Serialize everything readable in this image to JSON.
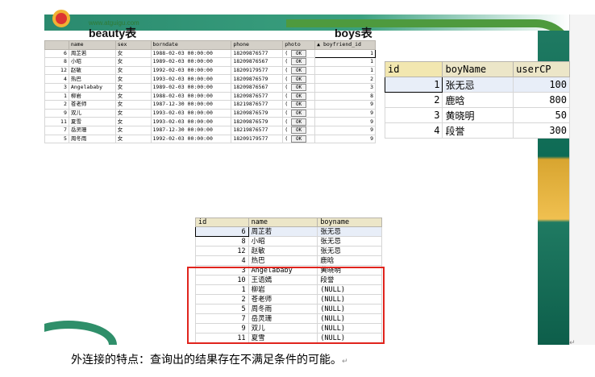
{
  "logo": {
    "url": "www.atguigu.com"
  },
  "captions": {
    "beauty": "beauty表",
    "boys": "boys表"
  },
  "beauty_table": {
    "columns": [
      "",
      "name",
      "sex",
      "borndate",
      "phone",
      "photo",
      "▲ boyfriend_id"
    ],
    "rows": [
      [
        "6",
        "周芷若",
        "女",
        "1988-02-03 00:00:00",
        "18209876577",
        "OK",
        "1"
      ],
      [
        "8",
        "小昭",
        "女",
        "1989-02-03 00:00:00",
        "18209876567",
        "OK",
        "1"
      ],
      [
        "12",
        "赵敏",
        "女",
        "1992-02-03 00:00:00",
        "18209179577",
        "OK",
        "1"
      ],
      [
        "4",
        "热巴",
        "女",
        "1993-02-03 00:00:00",
        "18209876579",
        "OK",
        "2"
      ],
      [
        "3",
        "Angelababy",
        "女",
        "1989-02-03 00:00:00",
        "18209876567",
        "OK",
        "3"
      ],
      [
        "1",
        "柳岩",
        "女",
        "1988-02-03 00:00:00",
        "18209876577",
        "OK",
        "8"
      ],
      [
        "2",
        "苍老师",
        "女",
        "1987-12-30 00:00:00",
        "18219876577",
        "OK",
        "9"
      ],
      [
        "9",
        "双儿",
        "女",
        "1993-02-03 00:00:00",
        "18209876579",
        "OK",
        "9"
      ],
      [
        "11",
        "夏雪",
        "女",
        "1993-02-03 00:00:00",
        "18209876579",
        "OK",
        "9"
      ],
      [
        "7",
        "岳灵珊",
        "女",
        "1987-12-30 00:00:00",
        "18219876577",
        "OK",
        "9"
      ],
      [
        "5",
        "周冬雨",
        "女",
        "1992-02-03 00:00:00",
        "18209179577",
        "OK",
        "9"
      ]
    ]
  },
  "boys_table": {
    "columns": [
      "id",
      "boyName",
      "userCP"
    ],
    "rows": [
      [
        "1",
        "张无忌",
        "100"
      ],
      [
        "2",
        "鹿晗",
        "800"
      ],
      [
        "3",
        "黄晓明",
        "50"
      ],
      [
        "4",
        "段誉",
        "300"
      ]
    ]
  },
  "result_table": {
    "columns": [
      "id",
      "name",
      "boyname"
    ],
    "rows": [
      [
        "6",
        "周芷若",
        "张无忌"
      ],
      [
        "8",
        "小昭",
        "张无忌"
      ],
      [
        "12",
        "赵敏",
        "张无忌"
      ],
      [
        "4",
        "热巴",
        "鹿晗"
      ],
      [
        "3",
        "Angelababy",
        "黄晓明"
      ],
      [
        "10",
        "王语嫣",
        "段誉"
      ],
      [
        "1",
        "柳岩",
        "(NULL)"
      ],
      [
        "2",
        "苍老师",
        "(NULL)"
      ],
      [
        "5",
        "周冬雨",
        "(NULL)"
      ],
      [
        "7",
        "岳灵珊",
        "(NULL)"
      ],
      [
        "9",
        "双儿",
        "(NULL)"
      ],
      [
        "11",
        "夏雪",
        "(NULL)"
      ]
    ]
  },
  "note": {
    "text": "外连接的特点：查询出的结果存在不满足条件的可能。",
    "mark": "↵"
  },
  "colors": {
    "highlight_border": "#e0241d",
    "slide_green": "#2a8a6e",
    "slide_gold": "#f0c050"
  }
}
